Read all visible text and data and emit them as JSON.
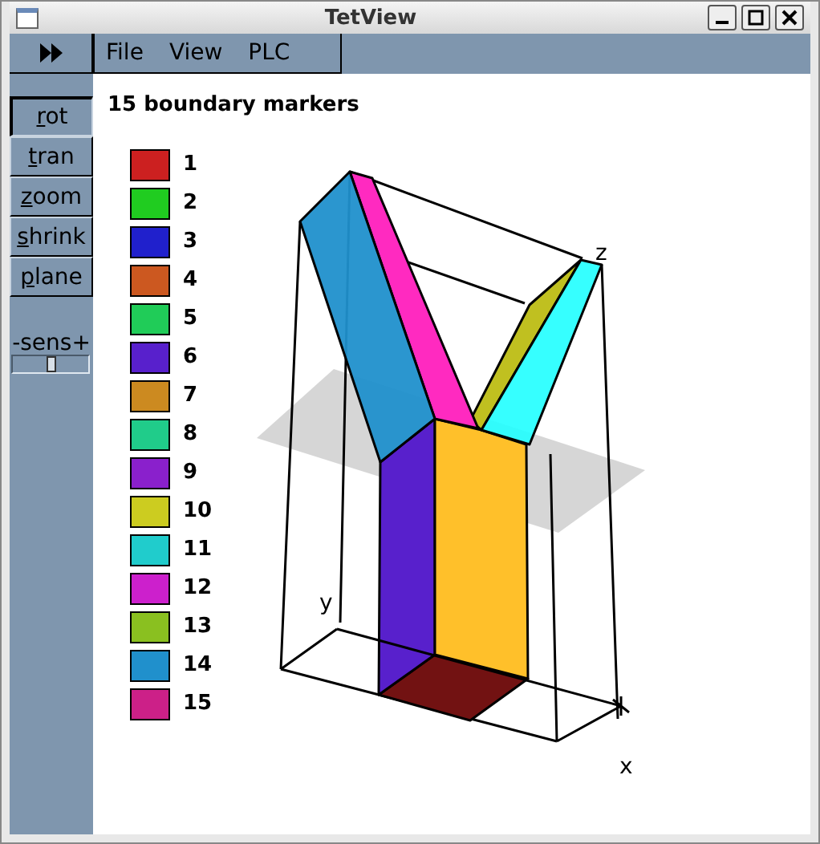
{
  "window": {
    "title": "TetView"
  },
  "menu": [
    "File",
    "View",
    "PLC"
  ],
  "tools": [
    {
      "label": "rot",
      "selected": true
    },
    {
      "label": "tran",
      "selected": false
    },
    {
      "label": "zoom",
      "selected": false
    },
    {
      "label": "shrink",
      "selected": false
    },
    {
      "label": "plane",
      "selected": false
    }
  ],
  "sensitivity": {
    "label": "-sens+",
    "level": 0.5
  },
  "canvas": {
    "title": "15 boundary markers",
    "legend": [
      {
        "label": "1",
        "color": "#cc2020"
      },
      {
        "label": "2",
        "color": "#20cc20"
      },
      {
        "label": "3",
        "color": "#2020cc"
      },
      {
        "label": "4",
        "color": "#cc5820"
      },
      {
        "label": "5",
        "color": "#20cc58"
      },
      {
        "label": "6",
        "color": "#5820cc"
      },
      {
        "label": "7",
        "color": "#cc8a20"
      },
      {
        "label": "8",
        "color": "#20cc8a"
      },
      {
        "label": "9",
        "color": "#8a20cc"
      },
      {
        "label": "10",
        "color": "#cccc20"
      },
      {
        "label": "11",
        "color": "#20cccc"
      },
      {
        "label": "12",
        "color": "#cc20cc"
      },
      {
        "label": "13",
        "color": "#8ac020"
      },
      {
        "label": "14",
        "color": "#2090cc"
      },
      {
        "label": "15",
        "color": "#cc2088"
      }
    ],
    "axes": {
      "x": "x",
      "y": "y",
      "z": "z"
    }
  }
}
